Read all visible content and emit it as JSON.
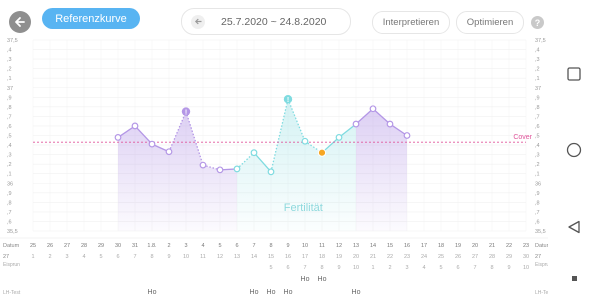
{
  "toolbar": {
    "reference_label": "Referenzkurve",
    "date_range": "25.7.2020 ~ 24.8.2020",
    "interpret_label": "Interpretieren",
    "optimize_label": "Optimieren",
    "help_label": "?"
  },
  "chart_data": {
    "type": "line",
    "ylim": [
      35.5,
      37.5
    ],
    "y_tick_labels_left": [
      "37,5",
      ",4",
      ",3",
      ",2",
      ",1",
      "37",
      ",9",
      ",8",
      ",7",
      ",6",
      ",5",
      ",4",
      ",3",
      ",2",
      ",1",
      "36",
      ",9",
      ",8",
      ",7",
      ",6",
      "35,5"
    ],
    "y_tick_labels_right": [
      "37,5",
      ",4",
      ",3",
      ",2",
      ",1",
      "37",
      ",9",
      ",8",
      ",7",
      ",6",
      ",5",
      ",4",
      ",3",
      ",2",
      ",1",
      "36",
      ",9",
      ",8",
      ",7",
      ",6",
      "35,5"
    ],
    "cover_line": {
      "label": "Cover",
      "value": 36.43
    },
    "fertile_window_label": "Fertilität",
    "date_labels": [
      "25",
      "26",
      "27",
      "28",
      "29",
      "30",
      "31",
      "1.8.",
      "2",
      "3",
      "4",
      "5",
      "6",
      "7",
      "8",
      "9",
      "10",
      "11",
      "12",
      "13",
      "14",
      "15",
      "16",
      "17",
      "18",
      "19",
      "20",
      "21",
      "22",
      "23"
    ],
    "cycle_day_labels": [
      "1",
      "2",
      "3",
      "4",
      "5",
      "6",
      "7",
      "8",
      "9",
      "10",
      "11",
      "12",
      "13",
      "14",
      "15",
      "16",
      "17",
      "18",
      "19",
      "20",
      "21",
      "22",
      "23",
      "24",
      "25",
      "26",
      "27",
      "28",
      "29",
      "30"
    ],
    "cycle_day_prefix": "27",
    "ovulation_day_labels": [
      "",
      "",
      "",
      "",
      "",
      "",
      "",
      "",
      "",
      "",
      "",
      "",
      "",
      "",
      "5",
      "6",
      "7",
      "8",
      "9",
      "10",
      "1",
      "2",
      "3",
      "4",
      "5",
      "6",
      "7",
      "8",
      "9",
      "10"
    ],
    "ho_row1": [
      "",
      "",
      "",
      "",
      "",
      "",
      "",
      "",
      "",
      "",
      "",
      "",
      "",
      "",
      "",
      "",
      "Ho",
      "Ho",
      "",
      "",
      "",
      "",
      "",
      "",
      "",
      "",
      "",
      "",
      "",
      ""
    ],
    "ho_row2": [
      "",
      "",
      "",
      "",
      "",
      "",
      "",
      "Ho",
      "",
      "",
      "",
      "",
      "",
      "Ho",
      "Ho",
      "Ho",
      "",
      "",
      "",
      "Ho",
      "",
      "",
      "",
      "",
      "",
      "",
      "",
      "",
      "",
      ""
    ],
    "row_labels": {
      "date": "Datum",
      "cycle": "Eisprun",
      "lh": "LH-Test"
    },
    "row_labels_right": {
      "date": "Datum",
      "cycle": "Eisprun",
      "lh": "LH-Test"
    },
    "temperatures": [
      {
        "day": 5,
        "value": 36.48
      },
      {
        "day": 6,
        "value": 36.6
      },
      {
        "day": 7,
        "value": 36.41
      },
      {
        "day": 8,
        "value": 36.33
      },
      {
        "day": 9,
        "value": 36.75,
        "marker": "!"
      },
      {
        "day": 10,
        "value": 36.19
      },
      {
        "day": 11,
        "value": 36.14
      },
      {
        "day": 12,
        "value": 36.15
      },
      {
        "day": 13,
        "value": 36.32
      },
      {
        "day": 14,
        "value": 36.12
      },
      {
        "day": 15,
        "value": 36.88,
        "marker": "!"
      },
      {
        "day": 16,
        "value": 36.44
      },
      {
        "day": 17,
        "value": 36.32,
        "marker": "star"
      },
      {
        "day": 18,
        "value": 36.48
      },
      {
        "day": 19,
        "value": 36.62
      },
      {
        "day": 20,
        "value": 36.78
      },
      {
        "day": 21,
        "value": 36.62
      },
      {
        "day": 22,
        "value": 36.5
      }
    ],
    "colors": {
      "purple": "#b497e6",
      "cyan": "#7fdbe0",
      "cover": "#e0559b",
      "fertility": "#9fe2e6"
    }
  }
}
